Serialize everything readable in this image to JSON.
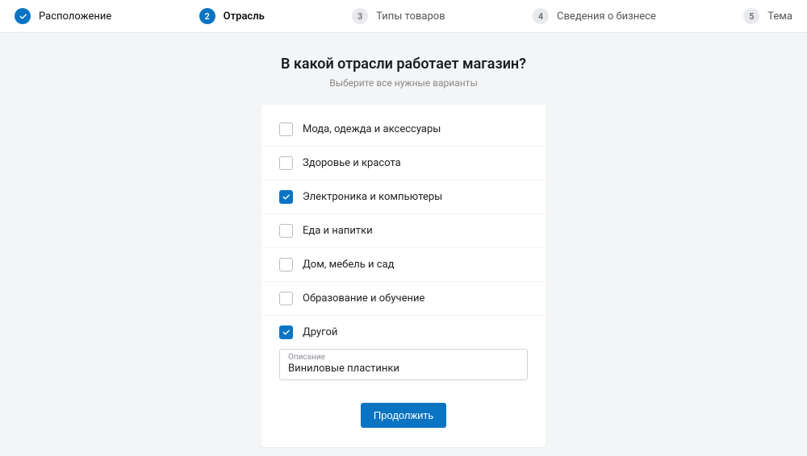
{
  "stepper": [
    {
      "state": "done",
      "label": "Расположение"
    },
    {
      "state": "active",
      "num": "2",
      "label": "Отрасль"
    },
    {
      "state": "todo",
      "num": "3",
      "label": "Типы товаров"
    },
    {
      "state": "todo",
      "num": "4",
      "label": "Сведения о бизнесе"
    },
    {
      "state": "todo",
      "num": "5",
      "label": "Тема"
    }
  ],
  "heading": "В какой отрасли работает магазин?",
  "subheading": "Выберите все нужные варианты",
  "options": [
    {
      "label": "Мода, одежда и аксессуары",
      "checked": false
    },
    {
      "label": "Здоровье и красота",
      "checked": false
    },
    {
      "label": "Электроника и компьютеры",
      "checked": true
    },
    {
      "label": "Еда и напитки",
      "checked": false
    },
    {
      "label": "Дом, мебель и сад",
      "checked": false
    },
    {
      "label": "Образование и обучение",
      "checked": false
    },
    {
      "label": "Другой",
      "checked": true
    }
  ],
  "description_field": {
    "floating_label": "Описание",
    "value": "Виниловые пластинки"
  },
  "continue_button": "Продолжить",
  "colors": {
    "accent": "#0a74c2"
  }
}
